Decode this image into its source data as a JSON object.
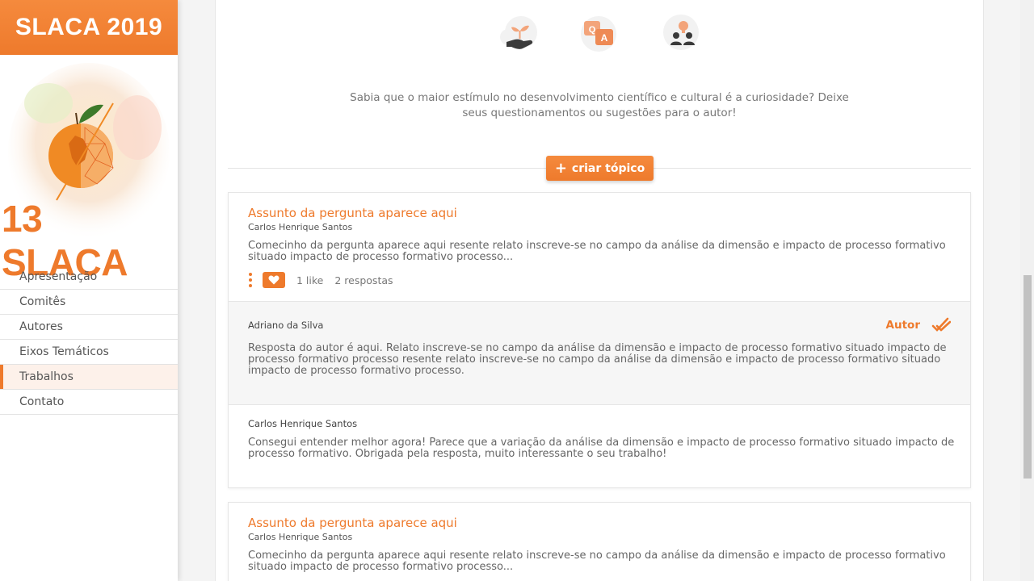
{
  "sidebar": {
    "brand": "SLACA 2019",
    "logo_text": "13 SLACA",
    "nav": [
      {
        "label": "Apresentação"
      },
      {
        "label": "Comitês"
      },
      {
        "label": "Autores"
      },
      {
        "label": "Eixos Temáticos"
      },
      {
        "label": "Trabalhos",
        "active": true
      },
      {
        "label": "Contato"
      }
    ]
  },
  "intro": {
    "text": "Sabia que o maior estímulo no desenvolvimento científico e cultural é a curiosidade? Deixe seus questionamentos ou sugestões para o autor!",
    "icons": [
      "hand-plant-icon",
      "qa-icon",
      "people-icon"
    ]
  },
  "create_topic": {
    "plus": "+",
    "label": "criar tópico"
  },
  "topics": [
    {
      "title": "Assunto da pergunta aparece aqui",
      "author": "Carlos Henrique Santos",
      "excerpt": "Comecinho da pergunta aparece aqui resente relato inscreve-se no campo da análise da dimensão e impacto de processo formativo situado impacto de processo formativo processo...",
      "likes": "1 like",
      "replies_count": "2 respostas",
      "replies": [
        {
          "name": "Adriano da Silva",
          "badge": "Autor",
          "text": "Resposta do autor é aqui. Relato inscreve-se no campo da análise da dimensão e impacto de processo formativo situado impacto de processo formativo processo resente relato inscreve-se no campo da análise da dimensão e impacto de processo formativo situado impacto de processo formativo processo."
        },
        {
          "name": "Carlos Henrique Santos",
          "text": "Consegui entender melhor agora! Parece que a variação da análise da dimensão e impacto de processo formativo situado impacto de processo formativo. Obrigada pela resposta, muito interessante o seu trabalho!"
        }
      ]
    },
    {
      "title": "Assunto da pergunta aparece aqui",
      "author": "Carlos Henrique Santos",
      "excerpt": "Comecinho da pergunta aparece aqui resente relato inscreve-se no campo da análise da dimensão e impacto de processo formativo situado impacto de processo formativo processo..."
    }
  ],
  "colors": {
    "accent": "#ee7a2c",
    "reply_bg": "#f6f6f6"
  }
}
